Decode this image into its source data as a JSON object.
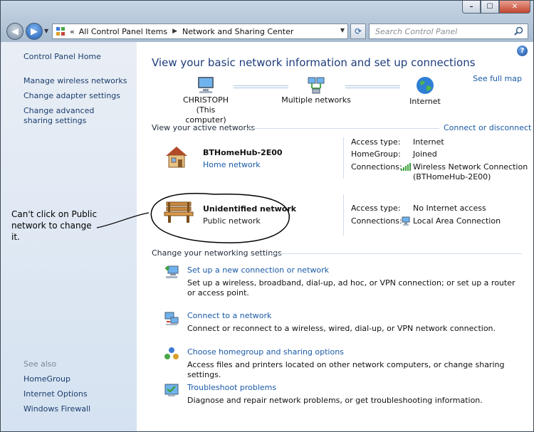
{
  "window": {
    "controls": {
      "minimize": "–",
      "maximize": "☐",
      "close": "✕"
    }
  },
  "navbar": {
    "breadcrumb_prefix": "«",
    "breadcrumbs": [
      "All Control Panel Items",
      "Network and Sharing Center"
    ],
    "search_placeholder": "Search Control Panel"
  },
  "sidebar": {
    "items": [
      {
        "label": "Control Panel Home"
      },
      {
        "label": "Manage wireless networks"
      },
      {
        "label": "Change adapter settings"
      },
      {
        "label": "Change advanced sharing settings"
      }
    ],
    "see_also_heading": "See also",
    "see_also": [
      {
        "label": "HomeGroup"
      },
      {
        "label": "Internet Options"
      },
      {
        "label": "Windows Firewall"
      }
    ]
  },
  "annotation": {
    "text": "Can't click on Public network to change it."
  },
  "main": {
    "help_label": "?",
    "title": "View your basic network information and set up connections",
    "see_full_map": "See full map",
    "map": {
      "computer_name": "CHRISTOPH",
      "computer_caption": "(This computer)",
      "middle": "Multiple networks",
      "internet": "Internet"
    },
    "active_networks": {
      "heading": "View your active networks",
      "connect_link": "Connect or disconnect",
      "networks": [
        {
          "name": "BTHomeHub-2E00",
          "type": "Home network",
          "access_type_label": "Access type:",
          "access_type": "Internet",
          "homegroup_label": "HomeGroup:",
          "homegroup": "Joined",
          "connections_label": "Connections:",
          "connection_line1": "Wireless Network Connection",
          "connection_line2": "(BTHomeHub-2E00)"
        },
        {
          "name": "Unidentified network",
          "type": "Public network",
          "access_type_label": "Access type:",
          "access_type": "No Internet access",
          "connections_label": "Connections:",
          "connection_line1": "Local Area Connection"
        }
      ]
    },
    "settings": {
      "heading": "Change your networking settings",
      "tasks": [
        {
          "title": "Set up a new connection or network",
          "desc1": "Set up a wireless, broadband, dial-up, ad hoc, or VPN connection; or set up a router or access",
          "desc2": "point."
        },
        {
          "title": "Connect to a network",
          "desc1": "Connect or reconnect to a wireless, wired, dial-up, or VPN network connection."
        },
        {
          "title": "Choose homegroup and sharing options",
          "desc1": "Access files and printers located on other network computers, or change sharing settings."
        },
        {
          "title": "Troubleshoot problems",
          "desc1": "Diagnose and repair network problems, or get troubleshooting information."
        }
      ]
    }
  },
  "colors": {
    "link": "#1a5aa6",
    "title": "#1e3d7b",
    "sidebar_bg": "#dfe8f3",
    "main_bg": "#ffffff"
  },
  "icons": {
    "back": "back-arrow-icon",
    "forward": "forward-arrow-icon",
    "refresh": "refresh-icon",
    "search": "search-icon",
    "help": "help-icon",
    "computer": "computer-icon",
    "network": "network-icon",
    "internet": "globe-icon",
    "home_network": "house-icon",
    "public_network": "park-bench-icon"
  }
}
